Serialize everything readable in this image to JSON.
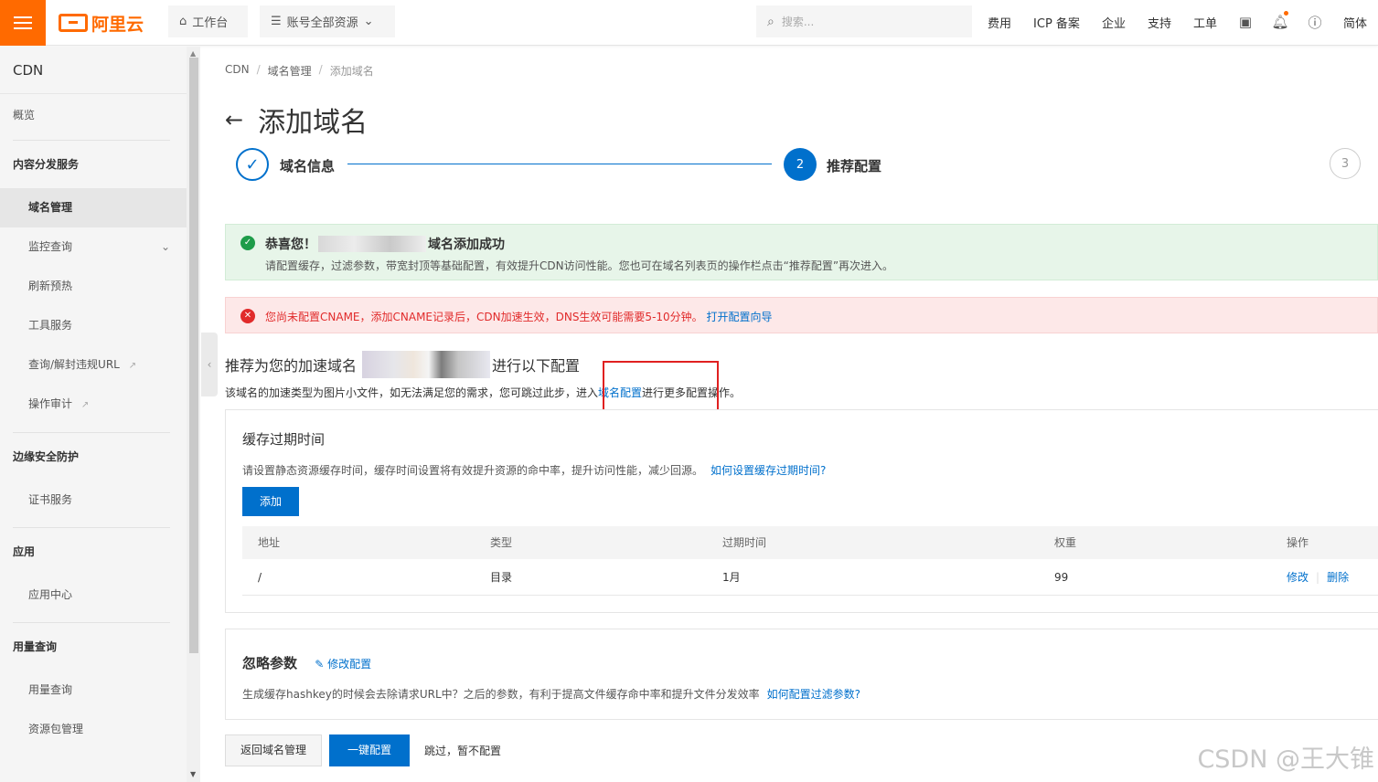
{
  "topbar": {
    "logo": "阿里云",
    "workbench": "工作台",
    "resources": "账号全部资源",
    "search_placeholder": "搜索...",
    "links": [
      "费用",
      "ICP 备案",
      "企业",
      "支持",
      "工单"
    ],
    "language": "简体"
  },
  "sidebar": {
    "title": "CDN",
    "overview": "概览",
    "groups": [
      {
        "title": "内容分发服务",
        "items": [
          "域名管理",
          "监控查询",
          "刷新预热",
          "工具服务",
          "查询/解封违规URL",
          "操作审计"
        ]
      },
      {
        "title": "边缘安全防护",
        "items": [
          "证书服务"
        ]
      },
      {
        "title": "应用",
        "items": [
          "应用中心"
        ]
      },
      {
        "title": "用量查询",
        "items": [
          "用量查询",
          "资源包管理"
        ]
      }
    ]
  },
  "breadcrumb": [
    "CDN",
    "域名管理",
    "添加域名"
  ],
  "page_title": "添加域名",
  "steps": [
    {
      "num": "✓",
      "label": "域名信息"
    },
    {
      "num": "2",
      "label": "推荐配置"
    },
    {
      "num": "3",
      "label": ""
    }
  ],
  "alert_success": {
    "title_prefix": "恭喜您！",
    "title_suffix": "域名添加成功",
    "body": "请配置缓存，过滤参数，带宽封顶等基础配置，有效提升CDN访问性能。您也可在域名列表页的操作栏点击“推荐配置”再次进入。"
  },
  "alert_error": {
    "text": "您尚未配置CNAME，添加CNAME记录后，CDN加速生效，DNS生效可能需要5-10分钟。",
    "link": "打开配置向导"
  },
  "recommend": {
    "title_prefix": "推荐为您的加速域名",
    "title_suffix": "进行以下配置",
    "desc_prefix": "该域名的加速类型为图片小文件，如无法满足您的需求，您可跳过此步，进入",
    "desc_link": "域名配置",
    "desc_suffix": "进行更多配置操作。"
  },
  "cache_card": {
    "title": "缓存过期时间",
    "desc": "请设置静态资源缓存时间，缓存时间设置将有效提升资源的命中率，提升访问性能，减少回源。",
    "help_link": "如何设置缓存过期时间?",
    "add_button": "添加",
    "columns": [
      "地址",
      "类型",
      "过期时间",
      "权重",
      "操作"
    ],
    "rows": [
      {
        "address": "/",
        "type": "目录",
        "expire": "1月",
        "weight": "99",
        "edit": "修改",
        "delete": "删除"
      }
    ]
  },
  "ignore_card": {
    "title": "忽略参数",
    "edit_link": "修改配置",
    "desc": "生成缓存hashkey的时候会去除请求URL中？之后的参数，有利于提高文件缓存命中率和提升文件分发效率",
    "help_link": "如何配置过滤参数?"
  },
  "footer": {
    "back_button": "返回域名管理",
    "apply_button": "一键配置",
    "skip_text": "跳过，暂不配置"
  },
  "watermark": "CSDN @王大锥",
  "colors": {
    "brand": "#ff6a00",
    "primary": "#0070cc",
    "success": "#1e9c49",
    "error": "#e12b2b"
  }
}
